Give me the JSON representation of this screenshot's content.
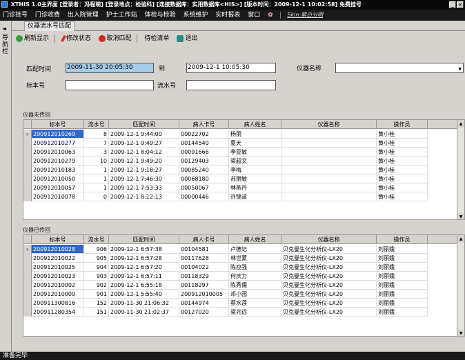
{
  "title_bar": {
    "text": "XTHIS 1.0主界面    [登录者：冯程萌]   [登录地点：检验科]   [连接数据库：实用数据库<HIS>]   [版本时间：2009-12-1 10:02:58]   免费挂号"
  },
  "menu": {
    "items": [
      "门诊挂号",
      "门诊收费",
      "出入院管理",
      "护士工作站",
      "体检与检验",
      "系统维护",
      "实时报表",
      "窗口"
    ],
    "skin_label": "Skin:紫白分明"
  },
  "sidebar": {
    "arrow": "◄",
    "label": "导航栏"
  },
  "tab": {
    "label": "仪器流水号匹配"
  },
  "toolbar": {
    "refresh": "刷新显示",
    "modify": "修改状态",
    "cancel": "取消匹配",
    "pending": "待检清单",
    "exit": "退出"
  },
  "filter": {
    "match_time_label": "匹配时间",
    "date_from": "2009-11-30 20:05:30",
    "to_label": "到",
    "date_to": "2009-12-1 10:05:30",
    "instrument_label": "仪器名称",
    "instrument_value": "",
    "specimen_label": "标本号",
    "specimen_value": "",
    "serial_label": "流水号",
    "serial_value": ""
  },
  "untransmitted": {
    "group_label": "仪器未传回",
    "columns": [
      "标本号",
      "流水号",
      "匹配时间",
      "病人卡号",
      "病人姓名",
      "仪器名称",
      "操作员"
    ],
    "rows": [
      [
        "200912010269",
        "8",
        "2009-12-1 9:44:00",
        "00022702",
        "杨丽",
        "",
        "黄小桂"
      ],
      [
        "200912010277",
        "7",
        "2009-12-1 9:49:27",
        "00144540",
        "夏天",
        "",
        "黄小桂"
      ],
      [
        "200912010063",
        "3",
        "2009-12-1 8:04:12",
        "00091666",
        "李亚敏",
        "",
        "黄小桂"
      ],
      [
        "200912010279",
        "10",
        "2009-12-1 9:49:20",
        "00129403",
        "梁超文",
        "",
        "黄小桂"
      ],
      [
        "200912010183",
        "1",
        "2009-12-1 9:18:27",
        "00085240",
        "李梅",
        "",
        "黄小桂"
      ],
      [
        "200912010050",
        "1",
        "2009-12-1 7:46:30",
        "00068180",
        "苏丽敏",
        "",
        "黄小桂"
      ],
      [
        "200912010057",
        "1",
        "2009-12-1 7:53:33",
        "00050067",
        "林燕丹",
        "",
        "黄小桂"
      ],
      [
        "200912010078",
        "0",
        "2009-12-1 8:12:13",
        "00000446",
        "许锦波",
        "",
        "黄小桂"
      ]
    ]
  },
  "transmitted": {
    "group_label": "仪器已传回",
    "columns": [
      "标本号",
      "流水号",
      "匹配时间",
      "病人卡号",
      "病人姓名",
      "仪器名称",
      "操作员"
    ],
    "rows": [
      [
        "200912010028",
        "906",
        "2009-12-1 6:57:38",
        "00104581",
        "卢德记",
        "贝克曼生化分析仪-LX20",
        "刘丽娥"
      ],
      [
        "200912010022",
        "905",
        "2009-12-1 6:57:28",
        "00117628",
        "林世蒙",
        "贝克曼生化分析仪-LX20",
        "刘丽娥"
      ],
      [
        "200912010025",
        "904",
        "2009-12-1 6:57:20",
        "00104022",
        "陈应强",
        "贝克曼生化分析仪-LX20",
        "刘丽娥"
      ],
      [
        "200912010023",
        "903",
        "2009-12-1 6:57:11",
        "00118329",
        "何庆力",
        "贝克曼生化分析仪-LX20",
        "刘丽娥"
      ],
      [
        "200912010002",
        "902",
        "2009-12-1 6:55:18",
        "00118297",
        "陈秀儒",
        "贝克曼生化分析仪-LX20",
        "刘丽娥"
      ],
      [
        "200912010009",
        "901",
        "2009-12-1 5:55:40",
        "200912010005",
        "邓小园",
        "贝克曼生化分析仪-LX20",
        "刘丽娥"
      ],
      [
        "200911300816",
        "152",
        "2009-11-30 21:06:32",
        "00144974",
        "蔡水莲",
        "贝克曼生化分析仪-LX20",
        "刘丽娥"
      ],
      [
        "200911280354",
        "151",
        "2009-11-30 21:02:37",
        "00127020",
        "梁兆远",
        "贝克曼生化分析仪-LX20",
        "刘丽娥"
      ]
    ]
  },
  "status": {
    "text": "准备完毕"
  },
  "colors": {
    "selected_row": "#3366cc",
    "active_input": "#a8cce8",
    "title_bar": "#0a0a0a"
  }
}
